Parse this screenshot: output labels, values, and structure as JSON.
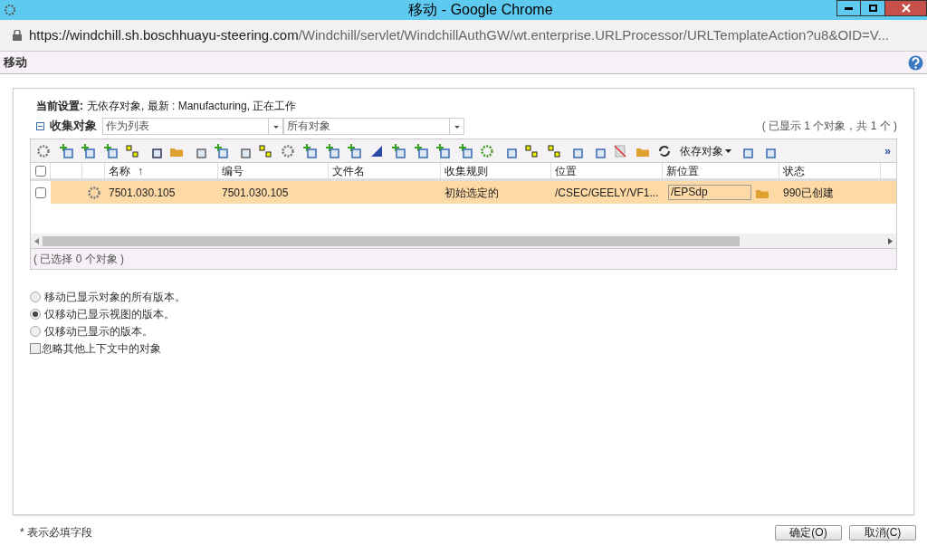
{
  "window": {
    "title": "移动 - Google Chrome"
  },
  "address_bar": {
    "host": "https://windchill.sh.boschhuayu-steering.com",
    "path": "/Windchill/servlet/WindchillAuthGW/wt.enterprise.URLProcessor/URLTemplateAction?u8&OID=V..."
  },
  "page_title": "移动",
  "current_settings": {
    "label": "当前设置:",
    "value": "无依存对象, 最新 : Manufacturing, 正在工作"
  },
  "collect": {
    "label": "收集对象",
    "expanded": true,
    "mode": "作为列表",
    "filter": "所有对象",
    "count": "( 已显示 1 个对象，共 1 个 )"
  },
  "toolbar": {
    "dependents_menu": "依存对象",
    "more": "»"
  },
  "table": {
    "columns": [
      "名称",
      "编号",
      "文件名",
      "收集规则",
      "位置",
      "新位置",
      "状态"
    ],
    "sort_mark": "↑",
    "select_all_checked": false,
    "rows": [
      {
        "selected": false,
        "name": "7501.030.105",
        "number": "7501.030.105",
        "file": "",
        "rule": "初始选定的",
        "location": "/CSEC/GEELY/VF1...",
        "new_location": "/EPSdp",
        "state": "990已创建"
      }
    ],
    "footer": "( 已选择 0 个对象 )"
  },
  "options": [
    {
      "label": "移动已显示对象的所有版本。",
      "selected": false
    },
    {
      "label": "仅移动已显示视图的版本。",
      "selected": true
    },
    {
      "label": "仅移动已显示的版本。",
      "selected": false
    }
  ],
  "ignore_other_contexts": {
    "label": "忽略其他上下文中的对象",
    "checked": false
  },
  "required_note": "* 表示必填字段",
  "buttons": [
    "确定(O)",
    "取消(C)"
  ]
}
